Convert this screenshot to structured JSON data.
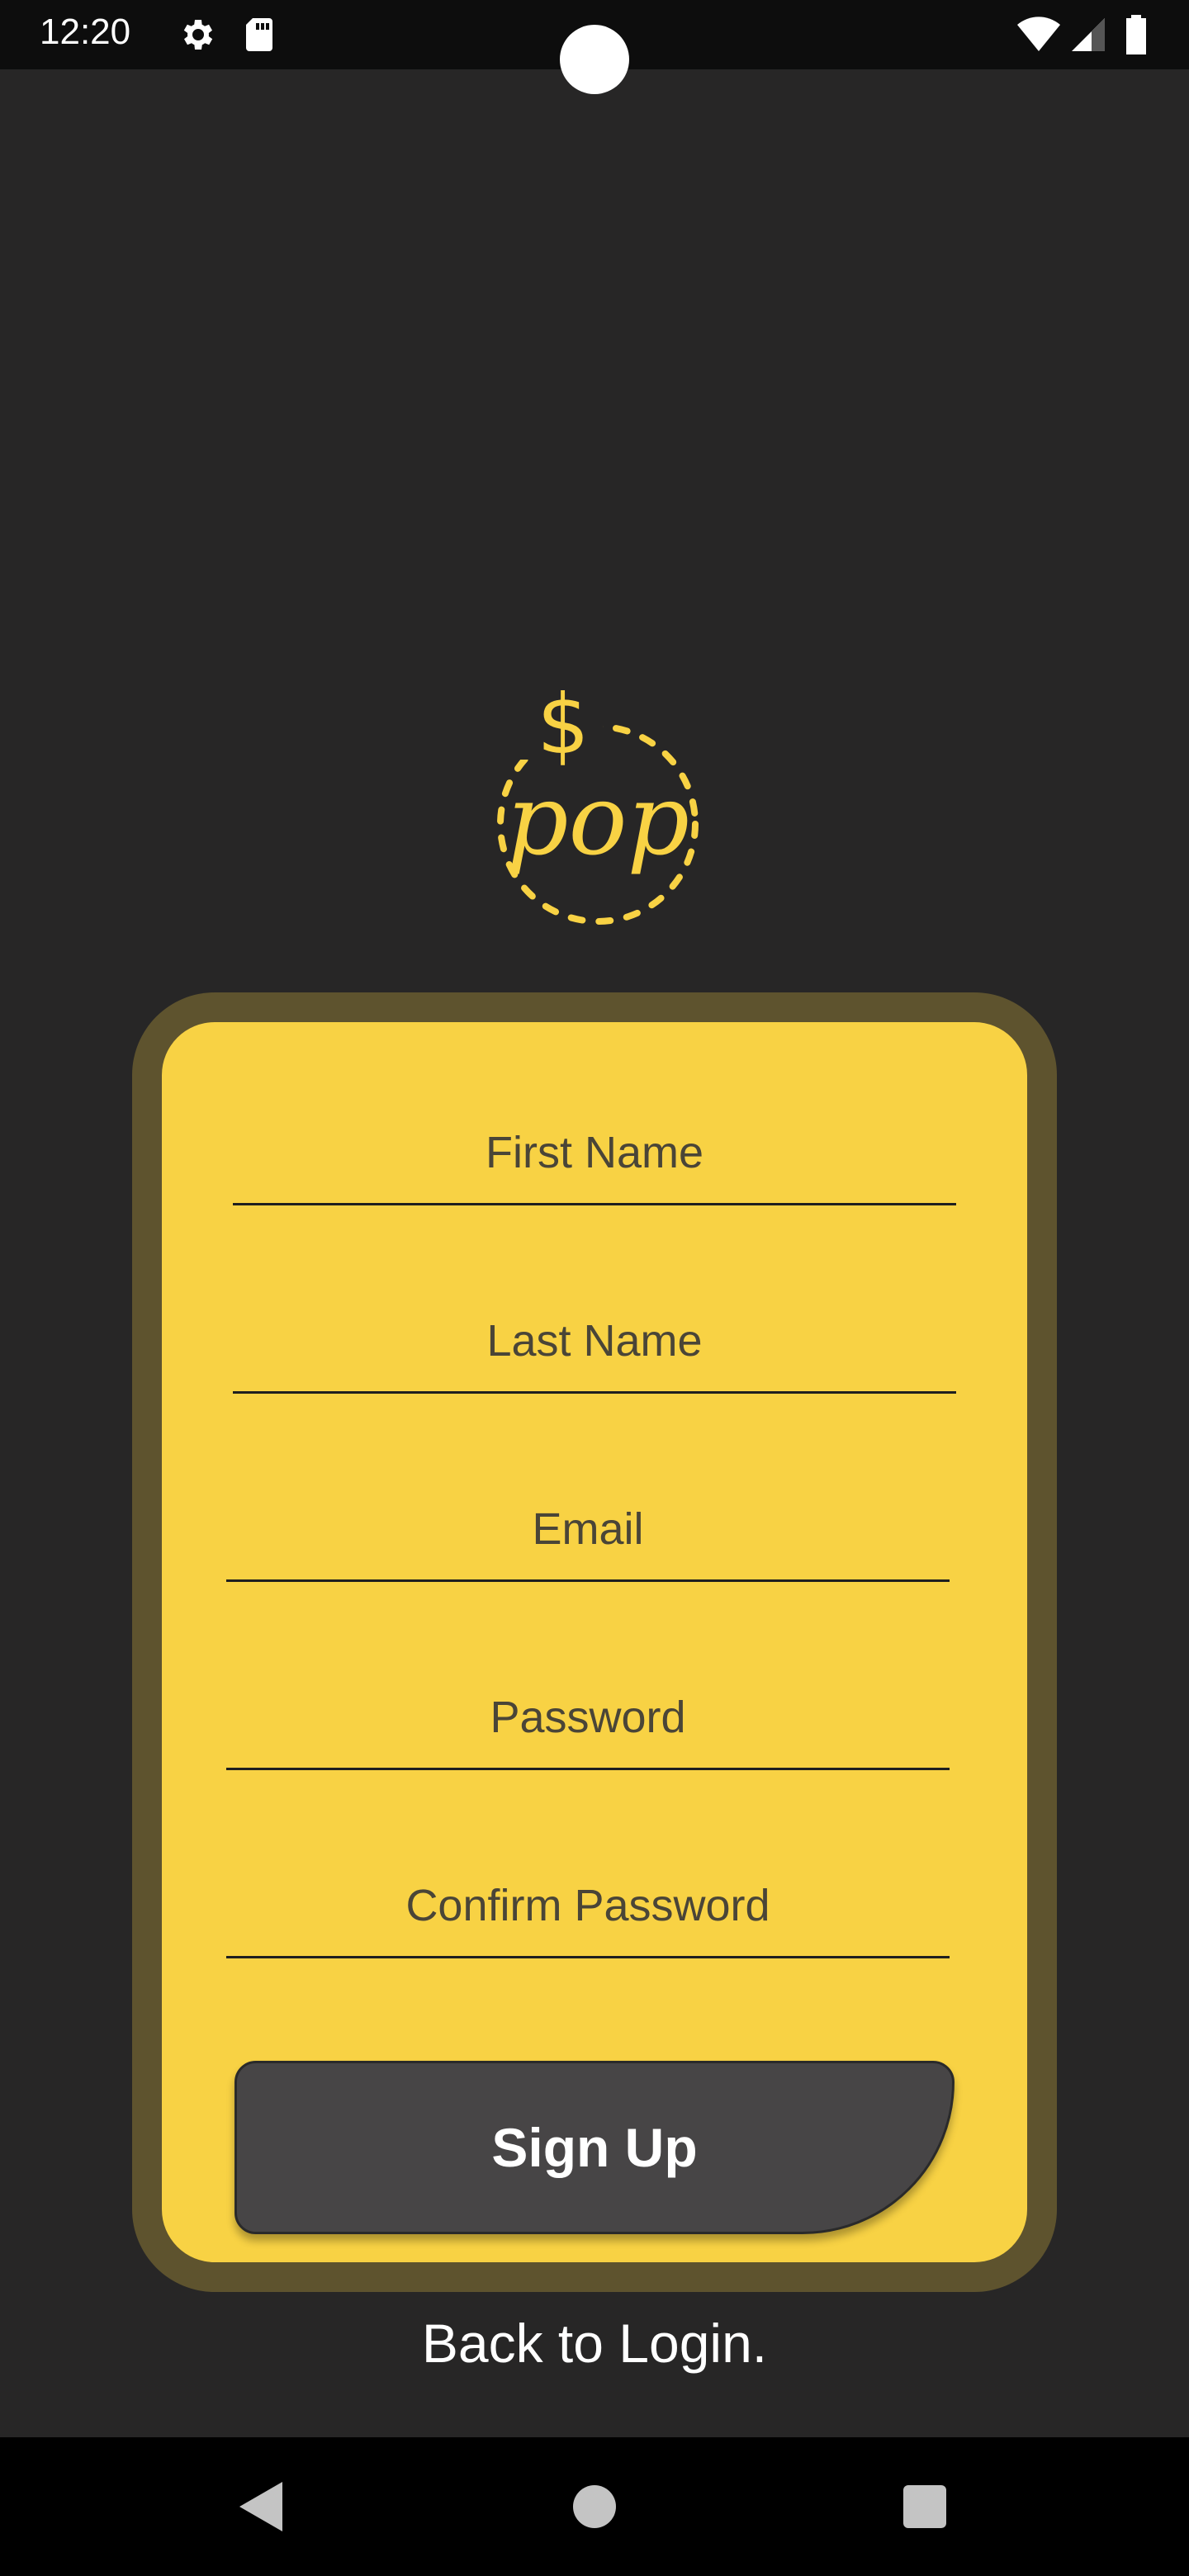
{
  "status_bar": {
    "time": "12:20",
    "icons": [
      "gear-icon",
      "sd-card-icon",
      "wifi-icon",
      "signal-icon",
      "battery-icon"
    ]
  },
  "logo": {
    "text": "pop",
    "symbol": "$",
    "color": "#f8d244"
  },
  "form": {
    "fields": [
      {
        "label": "First Name"
      },
      {
        "label": "Last Name"
      },
      {
        "label": "Email"
      },
      {
        "label": "Password"
      },
      {
        "label": "Confirm Password"
      }
    ],
    "submit_label": "Sign Up"
  },
  "back_link": "Back to Login.",
  "nav": {
    "icons": [
      "back-icon",
      "home-icon",
      "recents-icon"
    ]
  },
  "colors": {
    "background": "#272626",
    "card": "#f8d244",
    "card_border": "#5e532e",
    "button": "#474546"
  }
}
